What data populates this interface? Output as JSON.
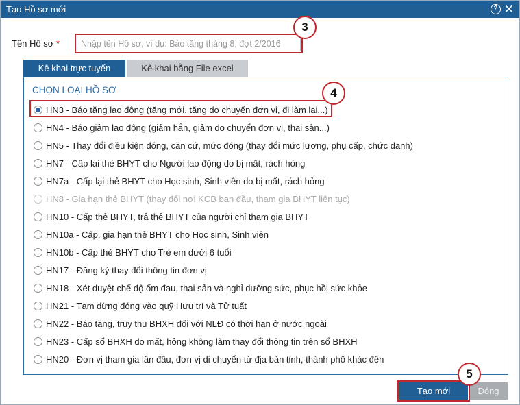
{
  "dialog": {
    "title": "Tạo Hồ sơ mới",
    "help_glyph": "?",
    "close_glyph": "✕"
  },
  "form": {
    "name_label": "Tên Hồ sơ",
    "required_mark": "*",
    "name_value": "",
    "name_placeholder": "Nhập tên Hồ sơ, ví dụ: Báo tăng tháng 8, đợt 2/2016"
  },
  "tabs": [
    {
      "label": "Kê khai trực tuyến",
      "active": true
    },
    {
      "label": "Kê khai bằng File excel",
      "active": false
    }
  ],
  "section_title": "CHỌN LOẠI HỒ SƠ",
  "options": [
    {
      "label": "HN3 - Báo tăng lao động (tăng mới, tăng do chuyển đơn vị, đi làm lại...)",
      "checked": true,
      "disabled": false
    },
    {
      "label": "HN4 - Báo giảm lao động (giảm hẳn, giảm do chuyển đơn vị, thai sản...)",
      "checked": false,
      "disabled": false
    },
    {
      "label": "HN5 - Thay đổi điều kiện đóng, căn cứ, mức đóng (thay đổi mức lương, phụ cấp, chức danh)",
      "checked": false,
      "disabled": false
    },
    {
      "label": "HN7 - Cấp lại thẻ BHYT cho Người lao động do bị mất, rách hỏng",
      "checked": false,
      "disabled": false
    },
    {
      "label": "HN7a - Cấp lại thẻ BHYT cho Học sinh, Sinh viên do bị mất, rách hỏng",
      "checked": false,
      "disabled": false
    },
    {
      "label": "HN8 - Gia hạn thẻ BHYT (thay đổi nơi KCB ban đầu, tham gia BHYT liên tục)",
      "checked": false,
      "disabled": true
    },
    {
      "label": "HN10 - Cấp thẻ BHYT, trả thẻ BHYT của người chỉ tham gia BHYT",
      "checked": false,
      "disabled": false
    },
    {
      "label": "HN10a - Cấp, gia hạn thẻ BHYT cho Học sinh, Sinh viên",
      "checked": false,
      "disabled": false
    },
    {
      "label": "HN10b - Cấp thẻ BHYT cho Trẻ em dưới 6 tuổi",
      "checked": false,
      "disabled": false
    },
    {
      "label": "HN17 - Đăng ký thay đổi thông tin đơn vị",
      "checked": false,
      "disabled": false
    },
    {
      "label": "HN18 - Xét duyệt chế độ ốm đau, thai sản và nghỉ dưỡng sức, phục hồi sức khỏe",
      "checked": false,
      "disabled": false
    },
    {
      "label": "HN21 - Tạm dừng đóng vào quỹ Hưu trí và Tử tuất",
      "checked": false,
      "disabled": false
    },
    {
      "label": "HN22 - Báo tăng, truy thu BHXH đối với NLĐ có thời hạn ở nước ngoài",
      "checked": false,
      "disabled": false
    },
    {
      "label": "HN23 - Cấp sổ BHXH do mất, hỏng không làm thay đổi thông tin trên sổ BHXH",
      "checked": false,
      "disabled": false
    },
    {
      "label": "HN20 - Đơn vị tham gia lần đầu, đơn vị di chuyển từ địa bàn tỉnh, thành phố khác đến",
      "checked": false,
      "disabled": false
    }
  ],
  "buttons": {
    "create_label": "Tạo mới",
    "close_label": "Đóng"
  },
  "callouts": {
    "step3": "3",
    "step4": "4",
    "step5": "5"
  },
  "colors": {
    "header_blue": "#1f5f96",
    "callout_red": "#c0282f",
    "section_blue": "#2d6ba5"
  }
}
